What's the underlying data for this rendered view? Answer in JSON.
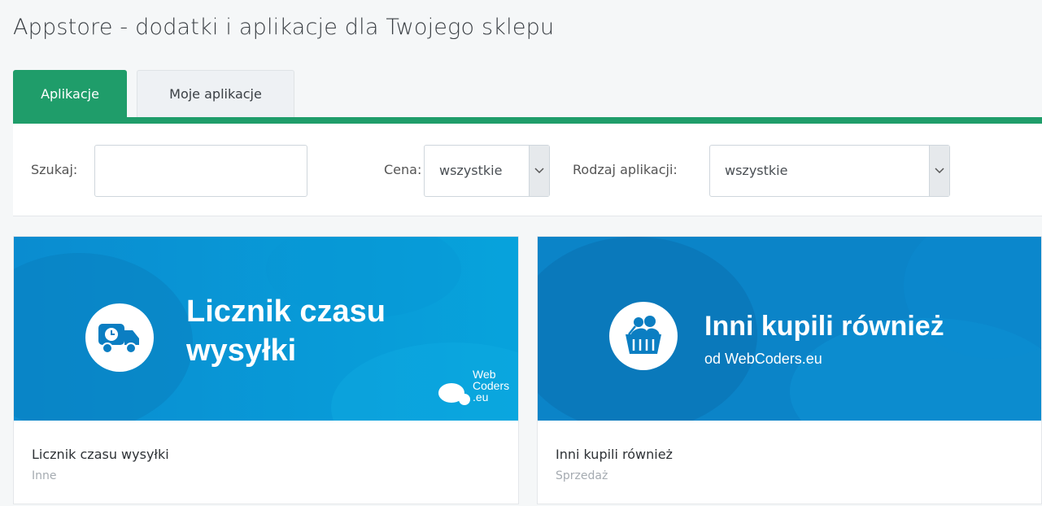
{
  "page": {
    "title": "Appstore - dodatki i aplikacje dla Twojego sklepu"
  },
  "tabs": [
    {
      "label": "Aplikacje",
      "active": true
    },
    {
      "label": "Moje aplikacje",
      "active": false
    }
  ],
  "filters": {
    "search": {
      "label": "Szukaj:",
      "value": "",
      "placeholder": ""
    },
    "price": {
      "label": "Cena:",
      "selected": "wszystkie"
    },
    "app_type": {
      "label": "Rodzaj aplikacji:",
      "selected": "wszystkie"
    }
  },
  "apps": [
    {
      "title": "Licznik czasu wysyłki",
      "category": "Inne",
      "banner": {
        "headline_line1": "Licznik czasu",
        "headline_line2": "wysyłki",
        "logo_line1": "Web",
        "logo_line2": "Coders",
        "logo_line3": ".eu",
        "icon": "delivery-truck-clock-icon"
      }
    },
    {
      "title": "Inni kupili również",
      "category": "Sprzedaż",
      "banner": {
        "headline": "Inni kupili również",
        "subline": "od WebCoders.eu",
        "icon": "shopping-basket-people-icon"
      }
    }
  ],
  "colors": {
    "accent": "#1f9d6a",
    "banner_blue_1": "#0a8fd1",
    "banner_blue_2": "#0e7fbf"
  }
}
